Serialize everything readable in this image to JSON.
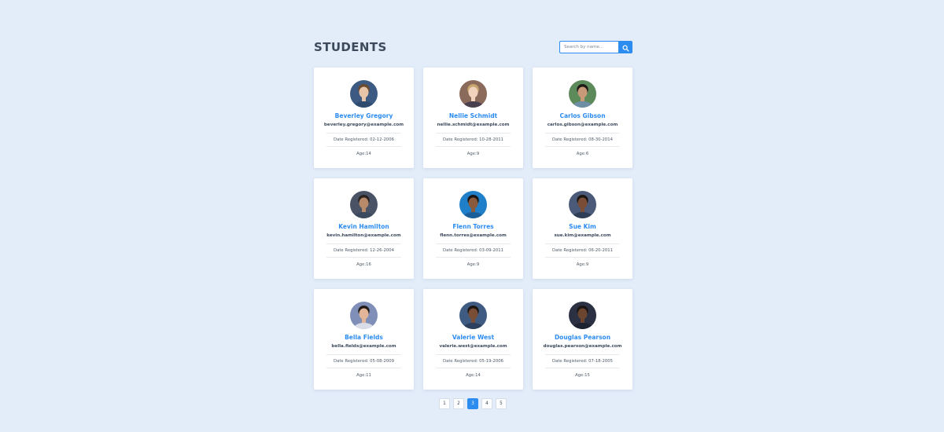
{
  "header": {
    "title": "STUDENTS"
  },
  "search": {
    "placeholder": "Search by name...",
    "value": "",
    "icon": "search-icon"
  },
  "students": [
    {
      "name": "Beverley Gregory",
      "email": "beverley.gregory@example.com",
      "date": "Date Registered: 02-12-2006",
      "age": "Age:14",
      "avatar": {
        "bg": "#3c5a82",
        "skin": "#e8c4a8",
        "hair": "#6b4a30",
        "shirt": "#2f4b70"
      }
    },
    {
      "name": "Nellie Schmidt",
      "email": "nellie.schmidt@example.com",
      "date": "Date Registered: 10-28-2011",
      "age": "Age:9",
      "avatar": {
        "bg": "#8a6a5a",
        "skin": "#f0d2bd",
        "hair": "#c9a56e",
        "shirt": "#4a3f4f"
      }
    },
    {
      "name": "Carlos Gibson",
      "email": "carlos.gibson@example.com",
      "date": "Date Registered: 08-30-2014",
      "age": "Age:6",
      "avatar": {
        "bg": "#5d8a5a",
        "skin": "#c99a78",
        "hair": "#1e1a18",
        "shirt": "#6f8fa6"
      }
    },
    {
      "name": "Kevin Hamilton",
      "email": "kevin.hamilton@example.com",
      "date": "Date Registered: 12-26-2004",
      "age": "Age:16",
      "avatar": {
        "bg": "#4a5366",
        "skin": "#b98a6a",
        "hair": "#2a2320",
        "shirt": "#3b4a5e"
      }
    },
    {
      "name": "Flenn Torres",
      "email": "flenn.torres@example.com",
      "date": "Date Registered: 03-09-2011",
      "age": "Age:9",
      "avatar": {
        "bg": "#1f7fc8",
        "skin": "#8a5a3c",
        "hair": "#1a1512",
        "shirt": "#1a5f9a"
      }
    },
    {
      "name": "Sue Kim",
      "email": "sue.kim@example.com",
      "date": "Date Registered: 06-20-2011",
      "age": "Age:9",
      "avatar": {
        "bg": "#4b5a78",
        "skin": "#7a4e36",
        "hair": "#1c1612",
        "shirt": "#2f3d55"
      }
    },
    {
      "name": "Bella Fields",
      "email": "bella.fields@example.com",
      "date": "Date Registered: 05-08-2009",
      "age": "Age:11",
      "avatar": {
        "bg": "#7f8fb8",
        "skin": "#e3b598",
        "hair": "#231b18",
        "shirt": "#d9dde8"
      }
    },
    {
      "name": "Valerie West",
      "email": "valerie.west@example.com",
      "date": "Date Registered: 05-19-2006",
      "age": "Age:14",
      "avatar": {
        "bg": "#3f5b82",
        "skin": "#7a4e36",
        "hair": "#1c1612",
        "shirt": "#2c3f5e"
      }
    },
    {
      "name": "Douglas Pearson",
      "email": "douglas.pearson@example.com",
      "date": "Date Registered: 07-18-2005",
      "age": "Age:15",
      "avatar": {
        "bg": "#2b3142",
        "skin": "#6b452f",
        "hair": "#1a1512",
        "shirt": "#1f2433"
      }
    }
  ],
  "pagination": {
    "pages": [
      "1",
      "2",
      "3",
      "4",
      "5"
    ],
    "current": "3"
  },
  "colors": {
    "accent": "#2d8cf0",
    "background": "#e3ecf9",
    "heading": "#3c4a5c"
  }
}
